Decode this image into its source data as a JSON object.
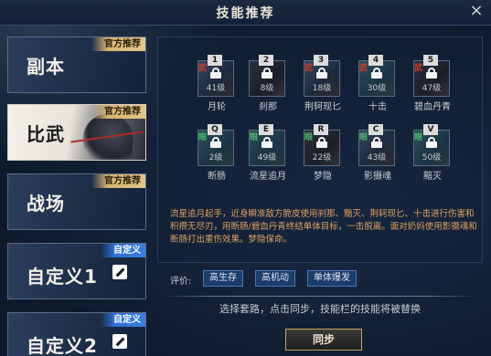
{
  "window": {
    "title": "技能推荐",
    "close_glyph": "×"
  },
  "tabs": [
    {
      "label": "副本",
      "badge": "官方推荐",
      "badge_color": "#d6b472",
      "active": false
    },
    {
      "label": "比武",
      "badge": "官方推荐",
      "badge_color": "#d6b472",
      "active": true
    },
    {
      "label": "战场",
      "badge": "官方推荐",
      "badge_color": "#d6b472",
      "active": false
    },
    {
      "label": "自定义1",
      "badge": "自定义",
      "badge_color": "#2f6ed2",
      "active": false,
      "icon": "edit-icon"
    },
    {
      "label": "自定义2",
      "badge": "自定义",
      "badge_color": "#2f6ed2",
      "active": false,
      "icon": "edit-icon"
    }
  ],
  "skills_row1": [
    {
      "key": "1",
      "type": "武",
      "level": "41级",
      "name": "月轮"
    },
    {
      "key": "2",
      "type": "",
      "level": "8级",
      "name": "刹那"
    },
    {
      "key": "3",
      "type": "武",
      "level": "18级",
      "name": "荆轲现匕"
    },
    {
      "key": "4",
      "type": "武",
      "level": "30级",
      "name": "十击"
    },
    {
      "key": "5",
      "type": "武",
      "level": "47级",
      "name": "碧血丹青"
    }
  ],
  "skills_row2": [
    {
      "key": "Q",
      "type": "眼",
      "level": "2级",
      "name": "断肠"
    },
    {
      "key": "E",
      "type": "眼",
      "level": "49级",
      "name": "流星追月"
    },
    {
      "key": "R",
      "type": "眼",
      "level": "22级",
      "name": "梦隐"
    },
    {
      "key": "C",
      "type": "眼",
      "level": "43级",
      "name": "影摄魂"
    },
    {
      "key": "V",
      "type": "眼",
      "level": "50级",
      "name": "黯灭"
    }
  ],
  "description": "流星追月起手，近身瞬准敌方脆皮使用刹那、黯灭、荆轲现匕、十击进行伤害和积攒无尽刃，用断肠/碧血丹青终结单体目标，一击脱离。面对奶妈使用影摄魂和断肠打出重伤效果。梦隐保命。",
  "rating": {
    "label": "评价:",
    "tags": [
      "高生存",
      "高机动",
      "单体爆发"
    ]
  },
  "hint": "选择套路，点击同步，技能栏的技能将被替换",
  "sync_button": "同步",
  "colors": {
    "martial_type": "#d23a2a",
    "eye_type": "#4ab86a",
    "description": "#e0a062",
    "tag_bg": "#1c3c6c"
  }
}
